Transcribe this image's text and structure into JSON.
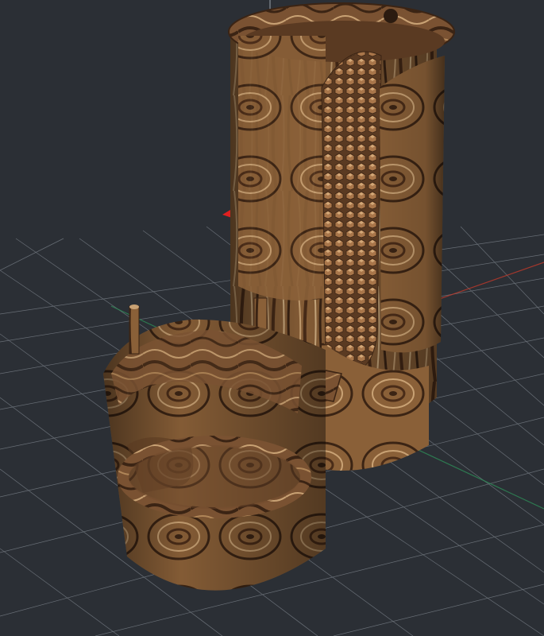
{
  "viewport": {
    "background": "#2b2f35",
    "grid_color": "#9aa2ab",
    "x_axis_color": "#c0392b",
    "y_axis_color": "#2e8b57",
    "gizmo_color": "#e02020"
  },
  "model": {
    "wood_dark": "#3b2414",
    "wood_mid": "#7a5232",
    "wood_light": "#c9a274",
    "honeycomb_color": "#a9764a"
  }
}
